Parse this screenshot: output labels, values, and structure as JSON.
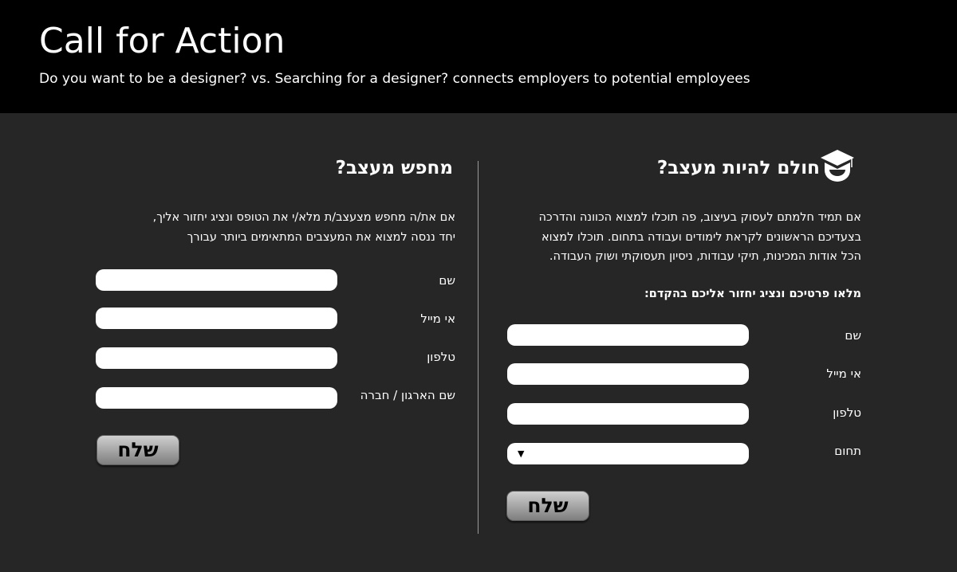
{
  "header": {
    "title": "Call for Action",
    "subtitle": "Do you want to be a designer? vs. Searching for a designer? connects employers to potential employees"
  },
  "right_panel": {
    "heading": "חולם להיות מעצב?",
    "icon": "graduation-cap-icon",
    "description_lines": [
      "אם תמיד חלמתם לעסוק בעיצוב, פה תוכלו למצוא הכוונה והדרכה",
      "בצעדיכם הראשונים לקראת לימודים ועבודה בתחום. תוכלו למצוא",
      "הכל אודות המכינות, תיקי עבודות, ניסיון תעסוקתי ושוק העבודה."
    ],
    "call_to_fill": "מלאו פרטיכם ונציג יחזור אליכם בהקדם:",
    "fields": {
      "name_label": "שם",
      "email_label": "אי מייל",
      "phone_label": "טלפון",
      "field_label": "תחום"
    },
    "send_label": "שלח"
  },
  "left_panel": {
    "heading": "מחפש מעצב?",
    "description_lines": [
      "אם את/ה מחפש מצעצב/ת מלא/י את הטופס ונציג יחזור אליך,",
      "יחד ננסה למצוא את המעצבים המתאימים ביותר עבורך"
    ],
    "fields": {
      "name_label": "שם",
      "email_label": "אי מייל",
      "phone_label": "טלפון",
      "org_label": "שם הארגון / חברה"
    },
    "send_label": "שלח"
  },
  "colors": {
    "header_bg": "#000000",
    "body_bg": "#262626",
    "text": "#ffffff",
    "input_bg": "#ffffff"
  }
}
